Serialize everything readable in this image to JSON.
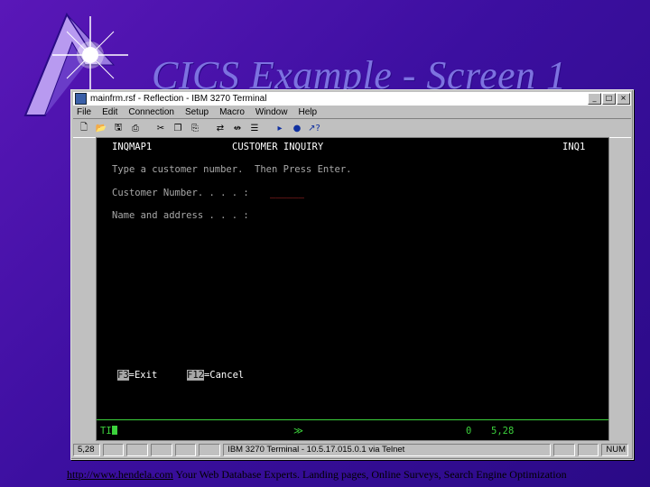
{
  "slide": {
    "title": "CICS Example - Screen 1",
    "footer_link": "http://www.hendela.com",
    "footer_text": "Your Web Database Experts. Landing pages, Online Surveys, Search Engine Optimization"
  },
  "window": {
    "title": "mainfrm.rsf - Reflection - IBM 3270 Terminal",
    "controls": [
      "_",
      "□",
      "×"
    ],
    "menu": [
      "File",
      "Edit",
      "Connection",
      "Setup",
      "Macro",
      "Window",
      "Help"
    ],
    "toolbar_icons": [
      "new-icon",
      "open-icon",
      "save-icon",
      "print-icon",
      "cut-icon",
      "copy-icon",
      "paste-icon",
      "connect-icon",
      "disconnect-icon",
      "macro-icon",
      "play-icon",
      "record-icon",
      "help-icon"
    ]
  },
  "terminal": {
    "map_name": "INQMAP1",
    "screen_title": "CUSTOMER INQUIRY",
    "transaction": "INQ1",
    "instruction": "Type a customer number.  Then Press Enter.",
    "customer_number_label": "Customer Number. . . . :",
    "customer_number_field": "______",
    "name_address_label": "Name and address . . . :",
    "f3_key": "F3",
    "f3_label": "=Exit",
    "f12_key": "F12",
    "f12_label": "=Cancel",
    "oia_status": "TI",
    "oia_arrow": "≫",
    "oia_count": "0",
    "cursor_position": "5,28"
  },
  "status_bar": {
    "position": "5,28",
    "connection": "IBM 3270 Terminal - 10.5.17.015.0.1 via Telnet",
    "num": "NUM"
  },
  "colors": {
    "background": "#3c0fa0",
    "title": "#7d72e0",
    "terminal_bg": "#000000",
    "terminal_green": "#3cd13c",
    "terminal_red": "#d83030"
  }
}
